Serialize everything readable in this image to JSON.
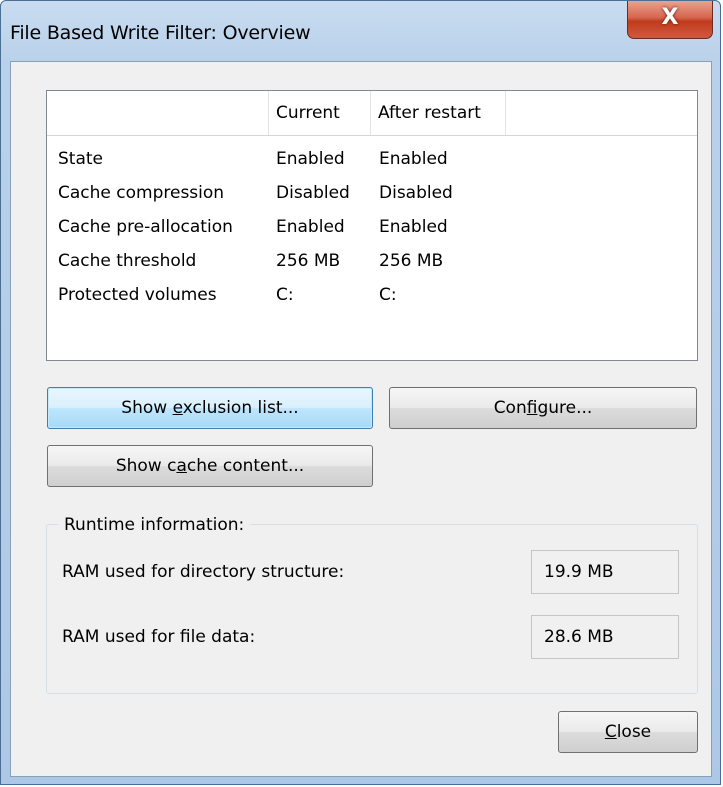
{
  "window": {
    "title": "File Based Write Filter: Overview",
    "close_glyph": "X"
  },
  "table": {
    "headers": [
      "",
      "Current",
      "After restart"
    ],
    "rows": [
      {
        "label": "State",
        "current": "Enabled",
        "after": "Enabled"
      },
      {
        "label": "Cache compression",
        "current": "Disabled",
        "after": "Disabled"
      },
      {
        "label": "Cache pre-allocation",
        "current": "Enabled",
        "after": "Enabled"
      },
      {
        "label": "Cache threshold",
        "current": "256 MB",
        "after": "256 MB"
      },
      {
        "label": "Protected volumes",
        "current": "C:",
        "after": "C:"
      }
    ]
  },
  "buttons": {
    "show_exclusion": {
      "pre": "Show ",
      "accel": "e",
      "post": "xclusion list..."
    },
    "configure": {
      "pre": "Con",
      "accel": "f",
      "post": "igure..."
    },
    "show_cache": {
      "pre": "Show c",
      "accel": "a",
      "post": "che content..."
    },
    "close": {
      "pre": "",
      "accel": "C",
      "post": "lose"
    }
  },
  "runtime": {
    "group_label": "Runtime information:",
    "dir_label": "RAM used for directory structure:",
    "dir_value": "19.9 MB",
    "file_label": "RAM used for file data:",
    "file_value": "28.6 MB"
  }
}
